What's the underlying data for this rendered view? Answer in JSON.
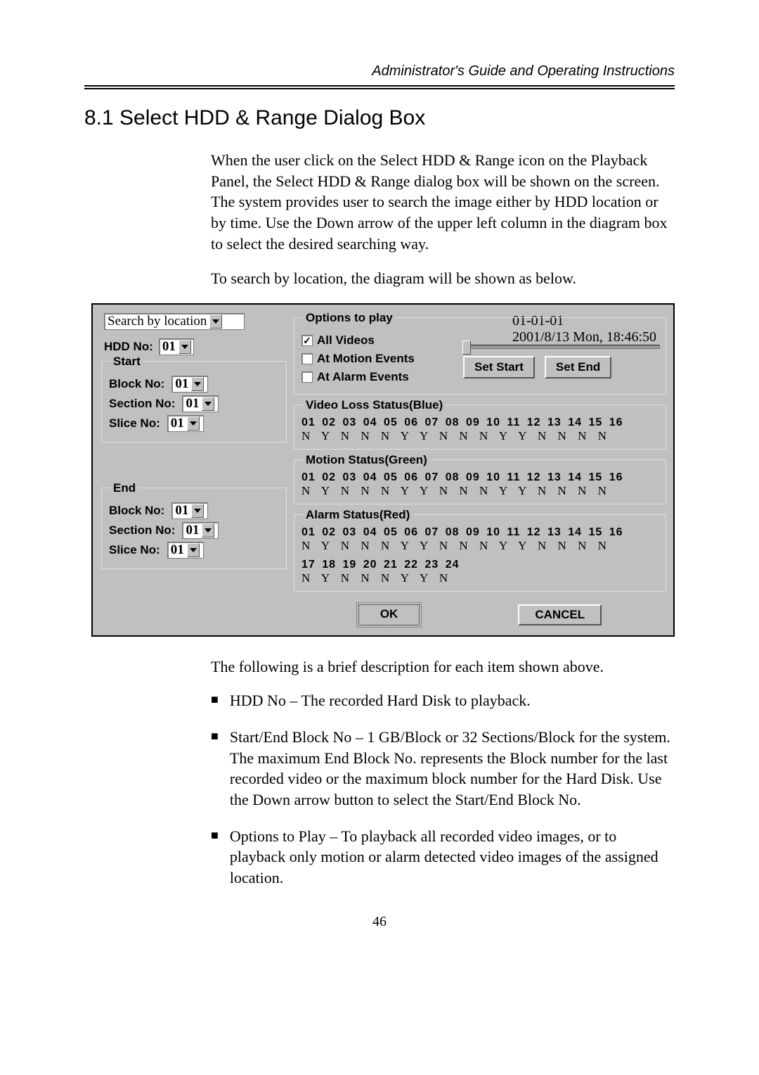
{
  "header": {
    "running": "Administrator's Guide and Operating Instructions"
  },
  "section": {
    "title": "8.1 Select HDD & Range Dialog Box"
  },
  "intro": {
    "p1": "When the user click on the Select HDD & Range icon on the Playback Panel, the Select HDD & Range dialog box will be shown on the screen. The system provides user to search the image either by HDD location or by time. Use the Down arrow of the upper left column in the diagram box to select the desired searching way.",
    "p2": "To search by location, the diagram will be shown as below."
  },
  "dialog": {
    "search_mode": "Search by location",
    "hdd_label": "HDD No:",
    "hdd_value": "01",
    "start_legend": "Start",
    "end_legend": "End",
    "block_label": "Block No:",
    "section_label": "Section No:",
    "slice_label": "Slice No:",
    "block_value": "01",
    "section_value": "01",
    "slice_value": "01",
    "options_legend": "Options to play",
    "opt_all": "All Videos",
    "opt_motion": "At Motion Events",
    "opt_alarm": "At Alarm Events",
    "time_line1": "01-01-01",
    "time_line2": "2001/8/13   Mon, 18:46:50",
    "set_start": "Set Start",
    "set_end": "Set End",
    "vloss_legend": "Video Loss Status(Blue)",
    "motion_legend": "Motion Status(Green)",
    "alarm_legend": "Alarm Status(Red)",
    "nums_1_16": "01 02 03 04 05 06 07 08 09 10 11 12 13 14 15 16",
    "flags_row": "N  Y  N  N  N  Y  Y  N  N  N  Y  Y  N  N  N  N",
    "nums_17_24": "17 18 19 20 21 22 23 24",
    "flags_17_24": "N  Y  N  N  N  Y  Y  N",
    "ok": "OK",
    "cancel": "CANCEL"
  },
  "after": {
    "summary": "The following is a brief description for each item shown above.",
    "b1": "HDD No – The recorded Hard Disk to playback.",
    "b2": "Start/End Block No – 1 GB/Block or 32 Sections/Block for the system.   The maximum End Block No. represents the Block number for the last recorded video or the maximum block number for the Hard Disk.   Use the Down arrow button to select the Start/End Block No.",
    "b3": "Options to Play – To playback all recorded video images, or to playback only motion or alarm detected video images of the assigned location."
  },
  "page_number": "46"
}
